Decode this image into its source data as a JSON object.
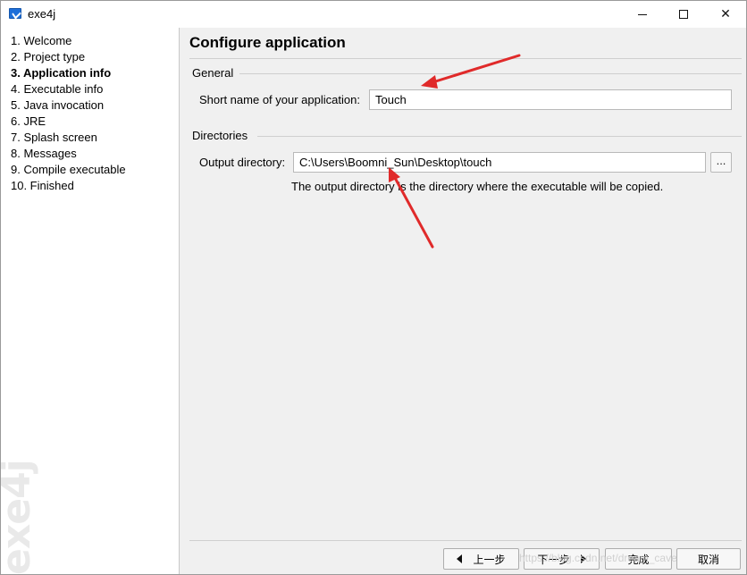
{
  "window": {
    "title": "exe4j",
    "minimize_glyph": "",
    "maximize_glyph": "",
    "close_glyph": "✕"
  },
  "sidebar": {
    "steps": [
      {
        "label": "1. Welcome"
      },
      {
        "label": "2. Project type"
      },
      {
        "label": "3. Application info",
        "active": true
      },
      {
        "label": "4. Executable info"
      },
      {
        "label": "5. Java invocation"
      },
      {
        "label": "6. JRE"
      },
      {
        "label": "7. Splash screen"
      },
      {
        "label": "8. Messages"
      },
      {
        "label": "9. Compile executable"
      },
      {
        "label": "10. Finished"
      }
    ],
    "watermark": "exe4j"
  },
  "main": {
    "title": "Configure application",
    "general": {
      "heading": "General",
      "short_name_label": "Short name of your application:",
      "short_name_value": "Touch"
    },
    "directories": {
      "heading": "Directories",
      "output_label": "Output directory:",
      "output_value": "C:\\Users\\Boomni_Sun\\Desktop\\touch",
      "browse_label": "...",
      "help": "The output directory is the directory where the executable will be copied."
    }
  },
  "buttons": {
    "back": "上一步",
    "next": "下一步",
    "finish": "完成",
    "cancel": "取消"
  },
  "overlay": {
    "watermark_text": "https://blog.csdn.net/dream_cave",
    "arrow_color": "#e02a2a"
  }
}
